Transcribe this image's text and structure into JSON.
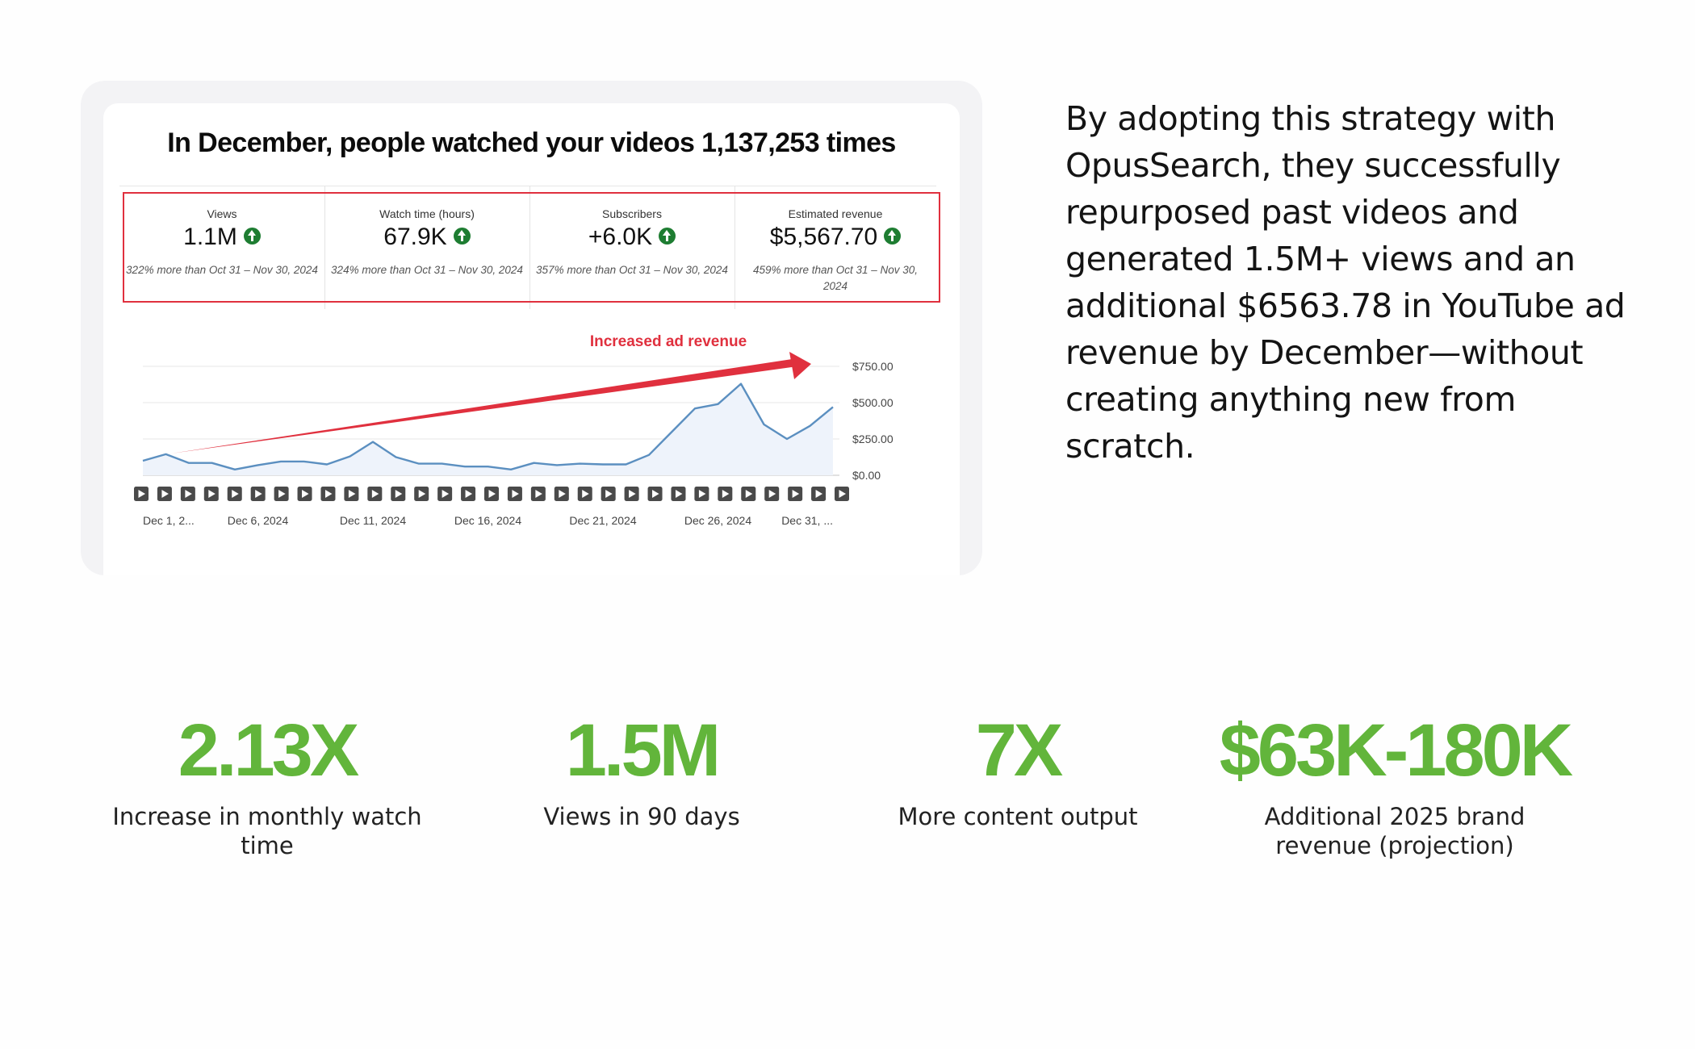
{
  "card": {
    "title": "In December, people watched your videos 1,137,253 times",
    "metrics": [
      {
        "label": "Views",
        "value": "1.1M",
        "note": "322% more than Oct 31 – Nov 30, 2024"
      },
      {
        "label": "Watch time (hours)",
        "value": "67.9K",
        "note": "324% more than Oct 31 – Nov 30, 2024"
      },
      {
        "label": "Subscribers",
        "value": "+6.0K",
        "note": "357% more than Oct 31 – Nov 30, 2024"
      },
      {
        "label": "Estimated revenue",
        "value": "$5,567.70",
        "note": "459% more than Oct 31 – Nov 30, 2024"
      }
    ],
    "annotation": "Increased ad revenue",
    "colors": {
      "highlight": "#e0303e",
      "up_badge": "#1e7d32",
      "line": "#5b8fc0",
      "area": "#eef3fb",
      "arrow": "#e0303e"
    }
  },
  "chart_data": {
    "type": "area",
    "y_axis": "right",
    "ylim": [
      0,
      750
    ],
    "yticks": [
      "$750.00",
      "$500.00",
      "$250.00",
      "$0.00"
    ],
    "ytick_values": [
      750,
      500,
      250,
      0
    ],
    "xticks": [
      "Dec 1, 2...",
      "Dec 6, 2024",
      "Dec 11, 2024",
      "Dec 16, 2024",
      "Dec 21, 2024",
      "Dec 26, 2024",
      "Dec 31, ..."
    ],
    "xtick_days": [
      1,
      6,
      11,
      16,
      21,
      26,
      31
    ],
    "x": [
      1,
      2,
      3,
      4,
      5,
      6,
      7,
      8,
      9,
      10,
      11,
      12,
      13,
      14,
      15,
      16,
      17,
      18,
      19,
      20,
      21,
      22,
      23,
      24,
      25,
      26,
      27,
      28,
      29,
      30,
      31
    ],
    "values": [
      100,
      145,
      85,
      85,
      40,
      70,
      95,
      95,
      75,
      130,
      230,
      125,
      80,
      80,
      60,
      60,
      40,
      85,
      70,
      80,
      75,
      75,
      140,
      300,
      460,
      490,
      630,
      350,
      250,
      340,
      470
    ],
    "video_markers": 31,
    "grid": true
  },
  "side_text": "By adopting this strategy with OpusSearch, they successfully repurposed past videos and generated 1.5M+ views and an additional $6563.78 in YouTube ad revenue by December—without creating anything new from scratch.",
  "stats": [
    {
      "value": "2.13X",
      "label": "Increase in monthly watch time"
    },
    {
      "value": "1.5M",
      "label": "Views in 90 days"
    },
    {
      "value": "7X",
      "label": "More content output"
    },
    {
      "value": "$63K-180K",
      "label": "Additional 2025 brand revenue (projection)"
    }
  ],
  "stat_color": "#62b53b"
}
